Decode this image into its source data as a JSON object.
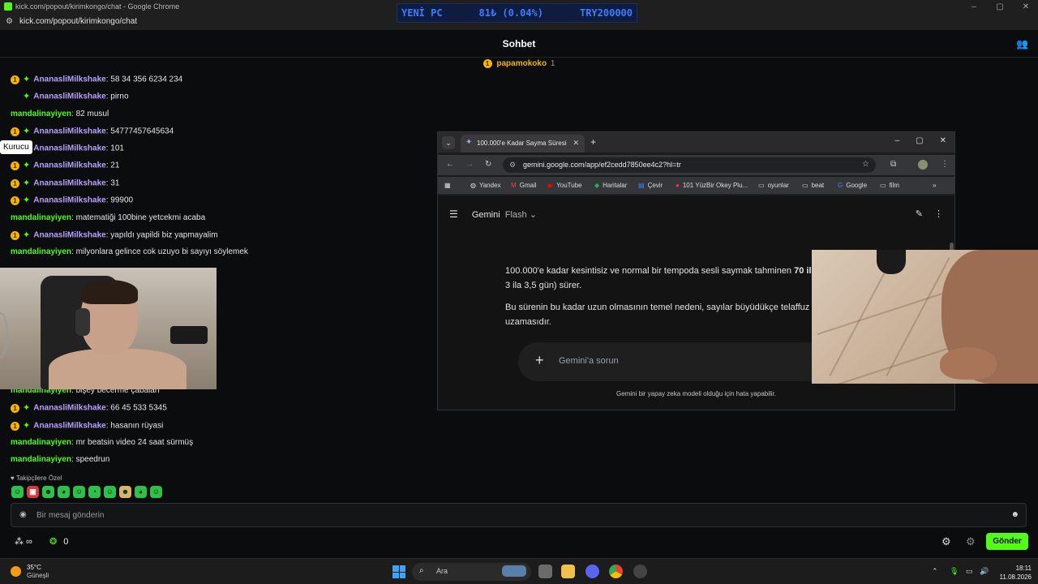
{
  "browser": {
    "window_title": "kick.com/popout/kirimkongo/chat - Google Chrome",
    "url": "kick.com/popout/kirimkongo/chat"
  },
  "ticker": {
    "left": "YENİ PC",
    "middle": "81₺ (0.04%)",
    "right": "TRY200000"
  },
  "chat": {
    "header_title": "Sohbet",
    "pinned": {
      "badge": "1",
      "name": "papamokoko",
      "count": "1"
    },
    "tooltip": "Kurucu",
    "messages": [
      {
        "badge": "1",
        "user": "AnanasliMilkshake",
        "text": "58 34 356 6234 234",
        "color": "purple"
      },
      {
        "badge": "",
        "user": "AnanasliMilkshake",
        "text": "pirno",
        "color": "purple"
      },
      {
        "badge": "",
        "user": "mandalinayiyen",
        "text": "82 musul",
        "color": "green"
      },
      {
        "badge": "1",
        "user": "AnanasliMilkshake",
        "text": "54777457645634",
        "color": "purple"
      },
      {
        "badge": "",
        "user": "AnanasliMilkshake",
        "text": "101",
        "color": "purple"
      },
      {
        "badge": "1",
        "user": "AnanasliMilkshake",
        "text": "21",
        "color": "purple"
      },
      {
        "badge": "1",
        "user": "AnanasliMilkshake",
        "text": "31",
        "color": "purple"
      },
      {
        "badge": "1",
        "user": "AnanasliMilkshake",
        "text": "99900",
        "color": "purple"
      },
      {
        "badge": "",
        "user": "mandalinayiyen",
        "text": "matematiği 100bine yetcekmi acaba",
        "color": "green"
      },
      {
        "badge": "1",
        "user": "AnanasliMilkshake",
        "text": "yapıldı yapildi biz yapmayalim",
        "color": "purple"
      },
      {
        "badge": "",
        "user": "mandalinayiyen",
        "text": "milyonlara gelince cok uzuyo bi sayıyı söylemek",
        "color": "green"
      },
      {
        "badge": "",
        "user": "mandalinayiyen",
        "text": "bişey becerme çabaları",
        "color": "green"
      },
      {
        "badge": "1",
        "user": "AnanasliMilkshake",
        "text": "66 45 533 5345",
        "color": "purple"
      },
      {
        "badge": "1",
        "user": "AnanasliMilkshake",
        "text": "hasanın rüyasi",
        "color": "purple"
      },
      {
        "badge": "",
        "user": "mandalinayiyen",
        "text": "mr beatsin video 24 saat sürmüş",
        "color": "green"
      },
      {
        "badge": "",
        "user": "mandalinayiyen",
        "text": "speedrun",
        "color": "green"
      }
    ],
    "follower_only": "Takipçilere Özel",
    "input_placeholder": "Bir mesaj gönderin",
    "points": "0",
    "send_label": "Gönder"
  },
  "gemini_window": {
    "tab_title": "100.000'e Kadar Sayma Süresi",
    "url": "gemini.google.com/app/ef2cedd7850ee4c2?hl=tr",
    "bookmarks": [
      "Yandex",
      "Gmail",
      "YouTube",
      "Haritalar",
      "Çevir",
      "101 YüzBir Okey Plu...",
      "oyunlar",
      "beat",
      "Google",
      "film"
    ],
    "app_name": "Gemini",
    "model": "Flash",
    "para1_prefix": "100.000'e kadar kesintisiz ve normal bir tempoda sesli saymak tahminen ",
    "para1_bold": "70 il",
    "para1_line2": "3 ila 3,5 gün) sürer.",
    "para2_line1": "Bu sürenin bu kadar uzun olmasının temel nedeni, sayılar büyüdükçe telaffuz s",
    "para2_line2": "uzamasıdır.",
    "input_placeholder": "Gemini'a sorun",
    "footer": "Gemini bir yapay zeka modeli olduğu için hata yapabilir."
  },
  "taskbar": {
    "temperature": "35°C",
    "condition": "Güneşli",
    "search": "Ara",
    "time": "18:11",
    "date": "11.08.2026"
  }
}
